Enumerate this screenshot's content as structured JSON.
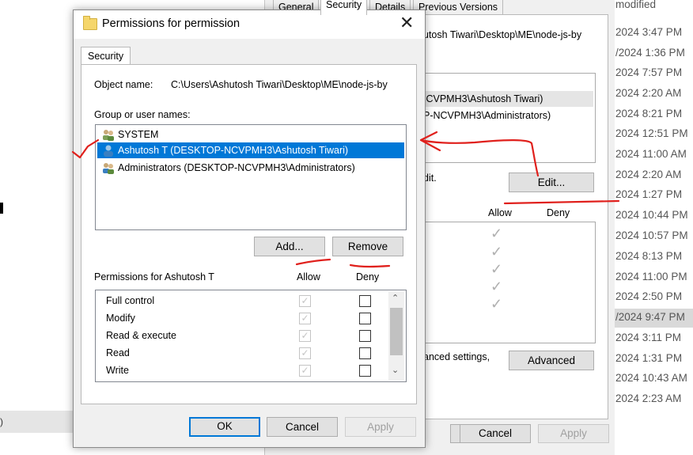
{
  "background": {
    "left_fragment": ")",
    "modified_header": "modified",
    "dates": [
      "2024 3:47 PM",
      "/2024 1:36 PM",
      "2024 7:57 PM",
      "2024 2:20 AM",
      "2024 8:21 PM",
      "2024 12:51 PM",
      "2024 11:00 AM",
      "2024 2:20 AM",
      "2024 1:27 PM",
      "2024 10:44 PM",
      "2024 10:57 PM",
      "2024 8:13 PM",
      "2024 11:00 PM",
      "2024 2:50 PM",
      "/2024 9:47 PM",
      "2024 3:11 PM",
      "2024 1:31 PM",
      "2024 10:43 AM",
      "2024 2:23 AM"
    ]
  },
  "props_window": {
    "tabs": [
      "General",
      "Security",
      "Details",
      "Previous Versions"
    ],
    "object_path_fragment": "utosh Tiwari\\Desktop\\ME\\node-js-by",
    "users": [
      "ICVPMH3\\Ashutosh Tiwari)",
      "P-NCVPMH3\\Administrators)"
    ],
    "edit_text_fragment": "dit.",
    "edit_button": "Edit...",
    "allow_header": "Allow",
    "deny_header": "Deny",
    "advanced_text_fragment": "anced settings,",
    "advanced_button": "Advanced",
    "cancel_button": "Cancel",
    "apply_button": "Apply",
    "check_glyph": "✓"
  },
  "dialog": {
    "title": "Permissions for permission",
    "close": "✕",
    "tab": "Security",
    "object_label": "Object name:",
    "object_value": "C:\\Users\\Ashutosh Tiwari\\Desktop\\ME\\node-js-by",
    "group_label": "Group or user names:",
    "users": [
      {
        "name": "SYSTEM",
        "selected": false
      },
      {
        "name": "Ashutosh T (DESKTOP-NCVPMH3\\Ashutosh Tiwari)",
        "selected": true
      },
      {
        "name": "Administrators (DESKTOP-NCVPMH3\\Administrators)",
        "selected": false
      }
    ],
    "add_button": "Add...",
    "remove_button": "Remove",
    "permissions_label": "Permissions for Ashutosh T",
    "allow_header": "Allow",
    "deny_header": "Deny",
    "permissions": [
      {
        "name": "Full control",
        "allow": true,
        "deny": false
      },
      {
        "name": "Modify",
        "allow": true,
        "deny": false
      },
      {
        "name": "Read & execute",
        "allow": true,
        "deny": false
      },
      {
        "name": "Read",
        "allow": true,
        "deny": false
      },
      {
        "name": "Write",
        "allow": true,
        "deny": false
      }
    ],
    "scroll_up": "⌃",
    "scroll_down": "⌄",
    "ok_button": "OK",
    "cancel_button": "Cancel",
    "apply_button": "Apply"
  },
  "annotation_color": "#e0201c",
  "selection_color": "#0078d7"
}
